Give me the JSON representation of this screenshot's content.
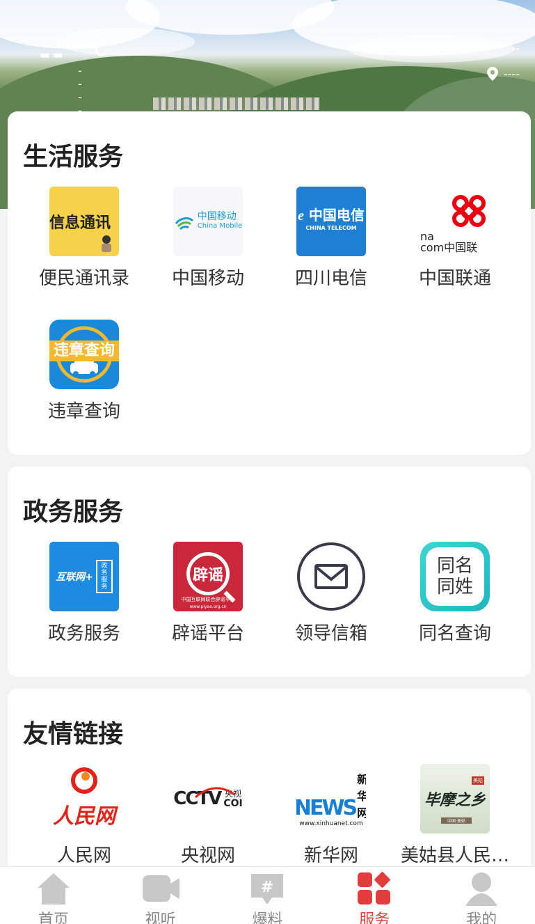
{
  "weather": {
    "temperature": "--",
    "unit": "℃",
    "condition": "----",
    "location_top": "--",
    "location": "----"
  },
  "sections": [
    {
      "title": "生活服务",
      "items": [
        {
          "label": "便民通讯录",
          "icon": "directory-icon"
        },
        {
          "label": "中国移动",
          "icon": "china-mobile-icon"
        },
        {
          "label": "四川电信",
          "icon": "china-telecom-icon"
        },
        {
          "label": "中国联通",
          "icon": "china-unicom-icon"
        },
        {
          "label": "违章查询",
          "icon": "traffic-violation-icon"
        }
      ]
    },
    {
      "title": "政务服务",
      "items": [
        {
          "label": "政务服务",
          "icon": "gov-service-icon"
        },
        {
          "label": "辟谣平台",
          "icon": "rumor-platform-icon"
        },
        {
          "label": "领导信箱",
          "icon": "mailbox-icon"
        },
        {
          "label": "同名查询",
          "icon": "same-name-icon"
        }
      ]
    },
    {
      "title": "友情链接",
      "items": [
        {
          "label": "人民网",
          "icon": "people-daily-icon"
        },
        {
          "label": "央视网",
          "icon": "cctv-icon"
        },
        {
          "label": "新华网",
          "icon": "xinhua-icon"
        },
        {
          "label": "美姑县人民…",
          "icon": "meigu-county-icon"
        }
      ]
    }
  ],
  "icon_text": {
    "directory": "信息通讯",
    "china_mobile_cn": "中国移动",
    "china_mobile_en": "China Mobile",
    "telecom_cn": "中国电信",
    "telecom_en": "CHINA TELECOM",
    "unicom_prefix": "na",
    "unicom_line2": "com中国联",
    "violation": "违章查询",
    "gov_badge": "互联网+",
    "gov_box": "政务服务",
    "rumor": "辟谣",
    "rumor_sub": "中国互联网联合辟谣平台",
    "rumor_url": "www.piyao.org.cn",
    "same_name_1": "同名",
    "same_name_2": "同姓",
    "people_daily": "人民网",
    "cctv_logo": "CCTV",
    "cctv_cn": "央视",
    "cctv_com": "COI",
    "xinhua_cn": "新华网",
    "xinhua_news": "NEWS",
    "xinhua_url": "www.xinhuanet.com",
    "meigu_art": "毕摩之乡",
    "meigu_tag": "美姑",
    "meigu_sub": "中国·美姑"
  },
  "tabbar": [
    {
      "label": "首页",
      "icon": "home-icon",
      "active": false
    },
    {
      "label": "视听",
      "icon": "video-camera-icon",
      "active": false
    },
    {
      "label": "爆料",
      "icon": "hashtag-icon",
      "active": false
    },
    {
      "label": "服务",
      "icon": "services-grid-icon",
      "active": true
    },
    {
      "label": "我的",
      "icon": "profile-icon",
      "active": false
    }
  ],
  "colors": {
    "accent": "#e23c3c",
    "inactive": "#c8c8c8"
  }
}
